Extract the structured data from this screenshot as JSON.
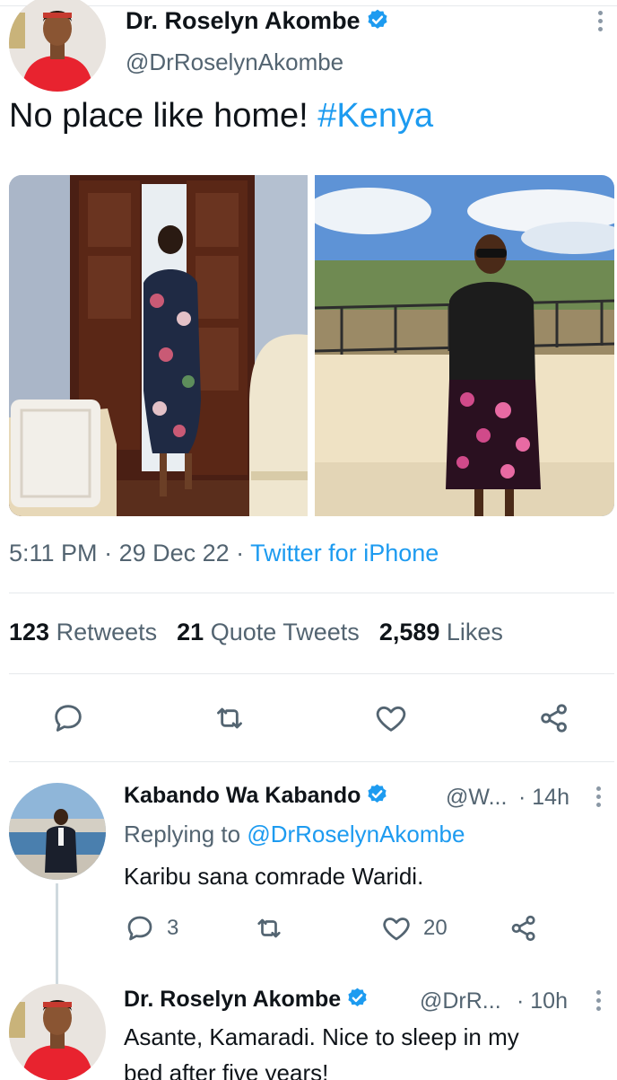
{
  "colors": {
    "accent": "#1d9bf0",
    "text": "#0f1419",
    "secondary": "#536471",
    "divider": "#e6e9ec"
  },
  "tweet": {
    "author_name": "Dr. Roselyn Akombe",
    "author_handle": "@DrRoselynAkombe",
    "text": "No place like home! ",
    "hashtag": "#Kenya",
    "time": "5:11 PM",
    "date": "29 Dec 22",
    "source": "Twitter for iPhone",
    "retweets_count": "123",
    "retweets_label": "Retweets",
    "quotes_count": "21",
    "quotes_label": "Quote Tweets",
    "likes_count": "2,589",
    "likes_label": "Likes",
    "actions": [
      "reply-icon",
      "retweet-icon",
      "like-icon",
      "share-icon"
    ]
  },
  "replies": [
    {
      "name": "Kabando Wa Kabando",
      "handle": "@W...",
      "time": "· 14h",
      "replying_prefix": "Replying to ",
      "replying_to": "@DrRoselynAkombe",
      "text": "Karibu sana comrade Waridi.",
      "reply_count": "3",
      "retweet_count": "",
      "like_count": "20"
    },
    {
      "name": "Dr. Roselyn Akombe",
      "handle": "@DrR...",
      "time": "· 10h",
      "text_line1": "Asante, Kamaradi. Nice to sleep in my",
      "text_line2": "bed after five years!"
    }
  ]
}
